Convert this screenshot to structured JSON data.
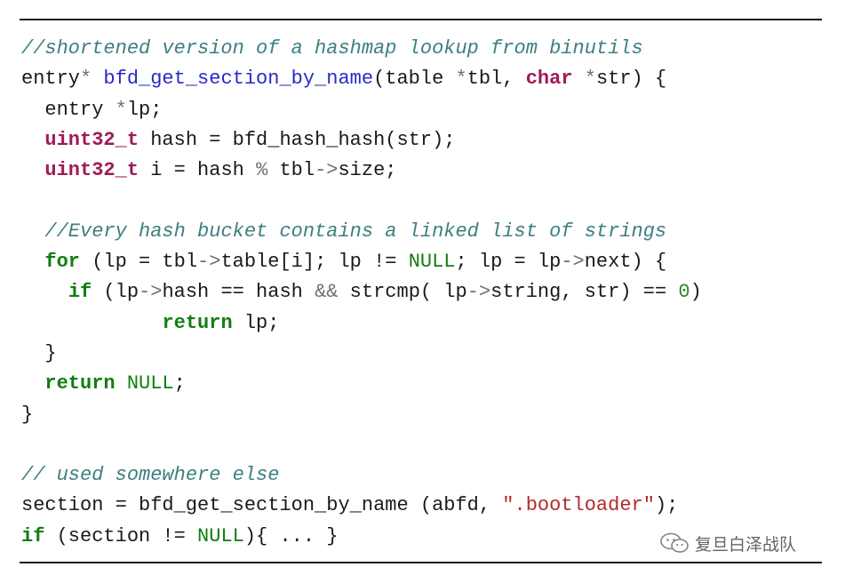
{
  "code_lines": [
    [
      {
        "t": "cm",
        "v": "//shortened version of a hashmap lookup from binutils"
      }
    ],
    [
      {
        "t": "",
        "v": "entry"
      },
      {
        "t": "op",
        "v": "*"
      },
      {
        "t": "",
        "v": " "
      },
      {
        "t": "fn",
        "v": "bfd_get_section_by_name"
      },
      {
        "t": "",
        "v": "(table "
      },
      {
        "t": "op",
        "v": "*"
      },
      {
        "t": "",
        "v": "tbl, "
      },
      {
        "t": "kt",
        "v": "char"
      },
      {
        "t": "",
        "v": " "
      },
      {
        "t": "op",
        "v": "*"
      },
      {
        "t": "",
        "v": "str) {"
      }
    ],
    [
      {
        "t": "",
        "v": "  entry "
      },
      {
        "t": "op",
        "v": "*"
      },
      {
        "t": "",
        "v": "lp;"
      }
    ],
    [
      {
        "t": "",
        "v": "  "
      },
      {
        "t": "kt",
        "v": "uint32_t"
      },
      {
        "t": "",
        "v": " hash = bfd_hash_hash(str);"
      }
    ],
    [
      {
        "t": "",
        "v": "  "
      },
      {
        "t": "kt",
        "v": "uint32_t"
      },
      {
        "t": "",
        "v": " i = hash "
      },
      {
        "t": "op",
        "v": "%"
      },
      {
        "t": "",
        "v": " tbl"
      },
      {
        "t": "op",
        "v": "->"
      },
      {
        "t": "",
        "v": "size;"
      }
    ],
    [],
    [
      {
        "t": "",
        "v": "  "
      },
      {
        "t": "cm",
        "v": "//Every hash bucket contains a linked list of strings"
      }
    ],
    [
      {
        "t": "",
        "v": "  "
      },
      {
        "t": "kw",
        "v": "for"
      },
      {
        "t": "",
        "v": " (lp = tbl"
      },
      {
        "t": "op",
        "v": "->"
      },
      {
        "t": "",
        "v": "table[i]; lp != "
      },
      {
        "t": "cst",
        "v": "NULL"
      },
      {
        "t": "",
        "v": "; lp = lp"
      },
      {
        "t": "op",
        "v": "->"
      },
      {
        "t": "",
        "v": "next) {"
      }
    ],
    [
      {
        "t": "",
        "v": "    "
      },
      {
        "t": "kw",
        "v": "if"
      },
      {
        "t": "",
        "v": " (lp"
      },
      {
        "t": "op",
        "v": "->"
      },
      {
        "t": "",
        "v": "hash == hash "
      },
      {
        "t": "op",
        "v": "&&"
      },
      {
        "t": "",
        "v": " strcmp( lp"
      },
      {
        "t": "op",
        "v": "->"
      },
      {
        "t": "",
        "v": "string, str) == "
      },
      {
        "t": "num",
        "v": "0"
      },
      {
        "t": "",
        "v": ")"
      }
    ],
    [
      {
        "t": "",
        "v": "            "
      },
      {
        "t": "kw",
        "v": "return"
      },
      {
        "t": "",
        "v": " lp;"
      }
    ],
    [
      {
        "t": "",
        "v": "  }"
      }
    ],
    [
      {
        "t": "",
        "v": "  "
      },
      {
        "t": "kw",
        "v": "return"
      },
      {
        "t": "",
        "v": " "
      },
      {
        "t": "cst",
        "v": "NULL"
      },
      {
        "t": "",
        "v": ";"
      }
    ],
    [
      {
        "t": "",
        "v": "}"
      }
    ],
    [],
    [
      {
        "t": "cm",
        "v": "// used somewhere else"
      }
    ],
    [
      {
        "t": "",
        "v": "section = bfd_get_section_by_name (abfd, "
      },
      {
        "t": "str",
        "v": "\".bootloader\""
      },
      {
        "t": "",
        "v": ");"
      }
    ],
    [
      {
        "t": "kw",
        "v": "if"
      },
      {
        "t": "",
        "v": " (section != "
      },
      {
        "t": "cst",
        "v": "NULL"
      },
      {
        "t": "",
        "v": "){ ... }"
      }
    ]
  ],
  "watermark": {
    "icon": "wechat-icon",
    "text": "复旦白泽战队"
  },
  "colors": {
    "comment": "#3d7f80",
    "function_name": "#2929c8",
    "type_keyword": "#a01a56",
    "control_keyword": "#117e11",
    "string": "#b52a2a"
  }
}
